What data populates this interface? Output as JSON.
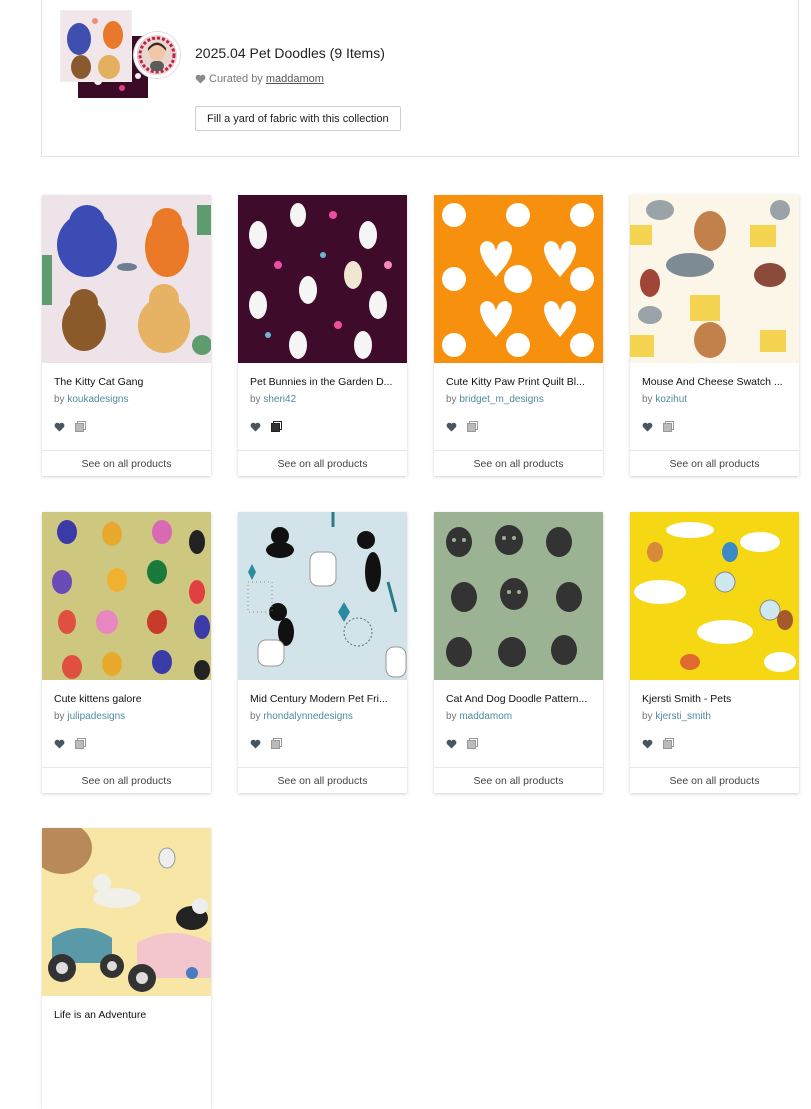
{
  "collection": {
    "title": "2025.04 Pet Doodles (9 Items)",
    "curated_prefix": "Curated by",
    "curator": "maddamom",
    "fill_button": "Fill a yard of fabric with this collection"
  },
  "by_prefix": "by",
  "see_label": "See on all products",
  "items": [
    {
      "title": "The Kitty Cat Gang",
      "designer": "koukadesigns",
      "saved": false
    },
    {
      "title": "Pet Bunnies in the Garden D...",
      "designer": "sheri42",
      "saved": true
    },
    {
      "title": "Cute Kitty Paw Print Quilt Bl...",
      "designer": "bridget_m_designs",
      "saved": false
    },
    {
      "title": "Mouse And Cheese Swatch ...",
      "designer": "kozihut",
      "saved": false
    },
    {
      "title": "Cute kittens galore",
      "designer": "julipadesigns",
      "saved": false
    },
    {
      "title": "Mid Century Modern Pet Fri...",
      "designer": "rhondalynnedesigns",
      "saved": false
    },
    {
      "title": "Cat And Dog Doodle Pattern...",
      "designer": "maddamom",
      "saved": false
    },
    {
      "title": "Kjersti Smith - Pets",
      "designer": "kjersti_smith",
      "saved": false
    },
    {
      "title": "Life is an Adventure",
      "designer": "",
      "saved": false
    }
  ],
  "icons": {
    "favorite": "heart-icon",
    "add_to_collection": "add-to-collection-icon"
  }
}
